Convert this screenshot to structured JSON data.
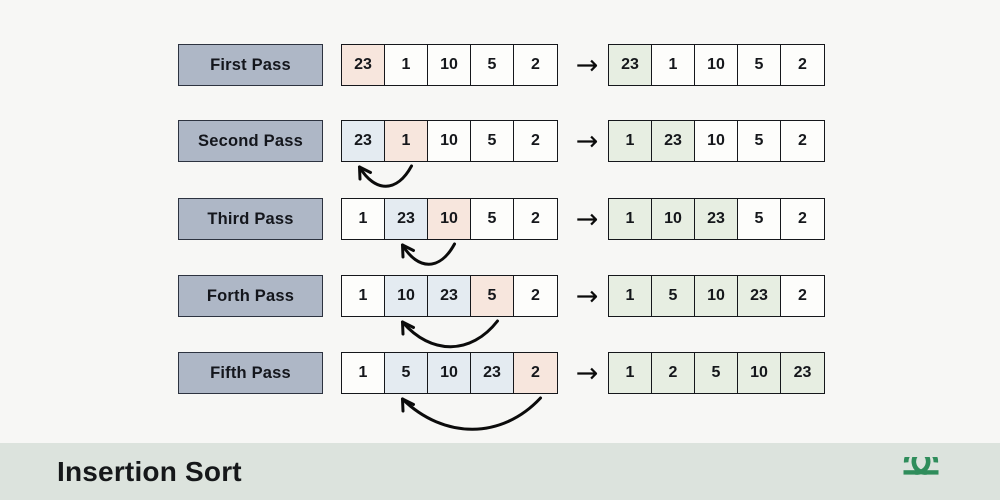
{
  "page": {
    "background_color": "#f7f7f5",
    "title": "Insertion Sort"
  },
  "colors": {
    "label_box": "#aeb7c6",
    "key_highlight": "#f7e6dd",
    "sorted_highlight": "#e4ebf1",
    "result_highlight": "#e7eee2",
    "border": "#15171b",
    "footer_background": "#dce3dd",
    "logo_green": "#2f8d5b"
  },
  "diagram": {
    "step_arrow_glyph": "→",
    "rows": [
      {
        "label": "First Pass",
        "before": {
          "values": [
            "23",
            "1",
            "10",
            "5",
            "2"
          ],
          "highlights": [
            "key",
            "none",
            "none",
            "none",
            "none"
          ]
        },
        "after": {
          "values": [
            "23",
            "1",
            "10",
            "5",
            "2"
          ],
          "highlights": [
            "done",
            "none",
            "none",
            "none",
            "none"
          ]
        },
        "swap_arrow": null
      },
      {
        "label": "Second Pass",
        "before": {
          "values": [
            "23",
            "1",
            "10",
            "5",
            "2"
          ],
          "highlights": [
            "sorted",
            "key",
            "none",
            "none",
            "none"
          ]
        },
        "after": {
          "values": [
            "1",
            "23",
            "10",
            "5",
            "2"
          ],
          "highlights": [
            "done",
            "done",
            "none",
            "none",
            "none"
          ]
        },
        "swap_arrow": {
          "from_index": 1,
          "to_index": 0
        }
      },
      {
        "label": "Third Pass",
        "before": {
          "values": [
            "1",
            "23",
            "10",
            "5",
            "2"
          ],
          "highlights": [
            "none",
            "sorted",
            "key",
            "none",
            "none"
          ]
        },
        "after": {
          "values": [
            "1",
            "10",
            "23",
            "5",
            "2"
          ],
          "highlights": [
            "done",
            "done",
            "done",
            "none",
            "none"
          ]
        },
        "swap_arrow": {
          "from_index": 2,
          "to_index": 1
        }
      },
      {
        "label": "Forth Pass",
        "before": {
          "values": [
            "1",
            "10",
            "23",
            "5",
            "2"
          ],
          "highlights": [
            "none",
            "sorted",
            "sorted",
            "key",
            "none"
          ]
        },
        "after": {
          "values": [
            "1",
            "5",
            "10",
            "23",
            "2"
          ],
          "highlights": [
            "done",
            "done",
            "done",
            "done",
            "none"
          ]
        },
        "swap_arrow": {
          "from_index": 3,
          "to_index": 1
        }
      },
      {
        "label": "Fifth Pass",
        "before": {
          "values": [
            "1",
            "5",
            "10",
            "23",
            "2"
          ],
          "highlights": [
            "none",
            "sorted",
            "sorted",
            "sorted",
            "key"
          ]
        },
        "after": {
          "values": [
            "1",
            "2",
            "5",
            "10",
            "23"
          ],
          "highlights": [
            "done",
            "done",
            "done",
            "done",
            "done"
          ]
        },
        "swap_arrow": {
          "from_index": 4,
          "to_index": 1
        }
      }
    ]
  },
  "footer": {
    "title": "Insertion Sort",
    "logo_name": "geeksforgeeks-logo"
  }
}
